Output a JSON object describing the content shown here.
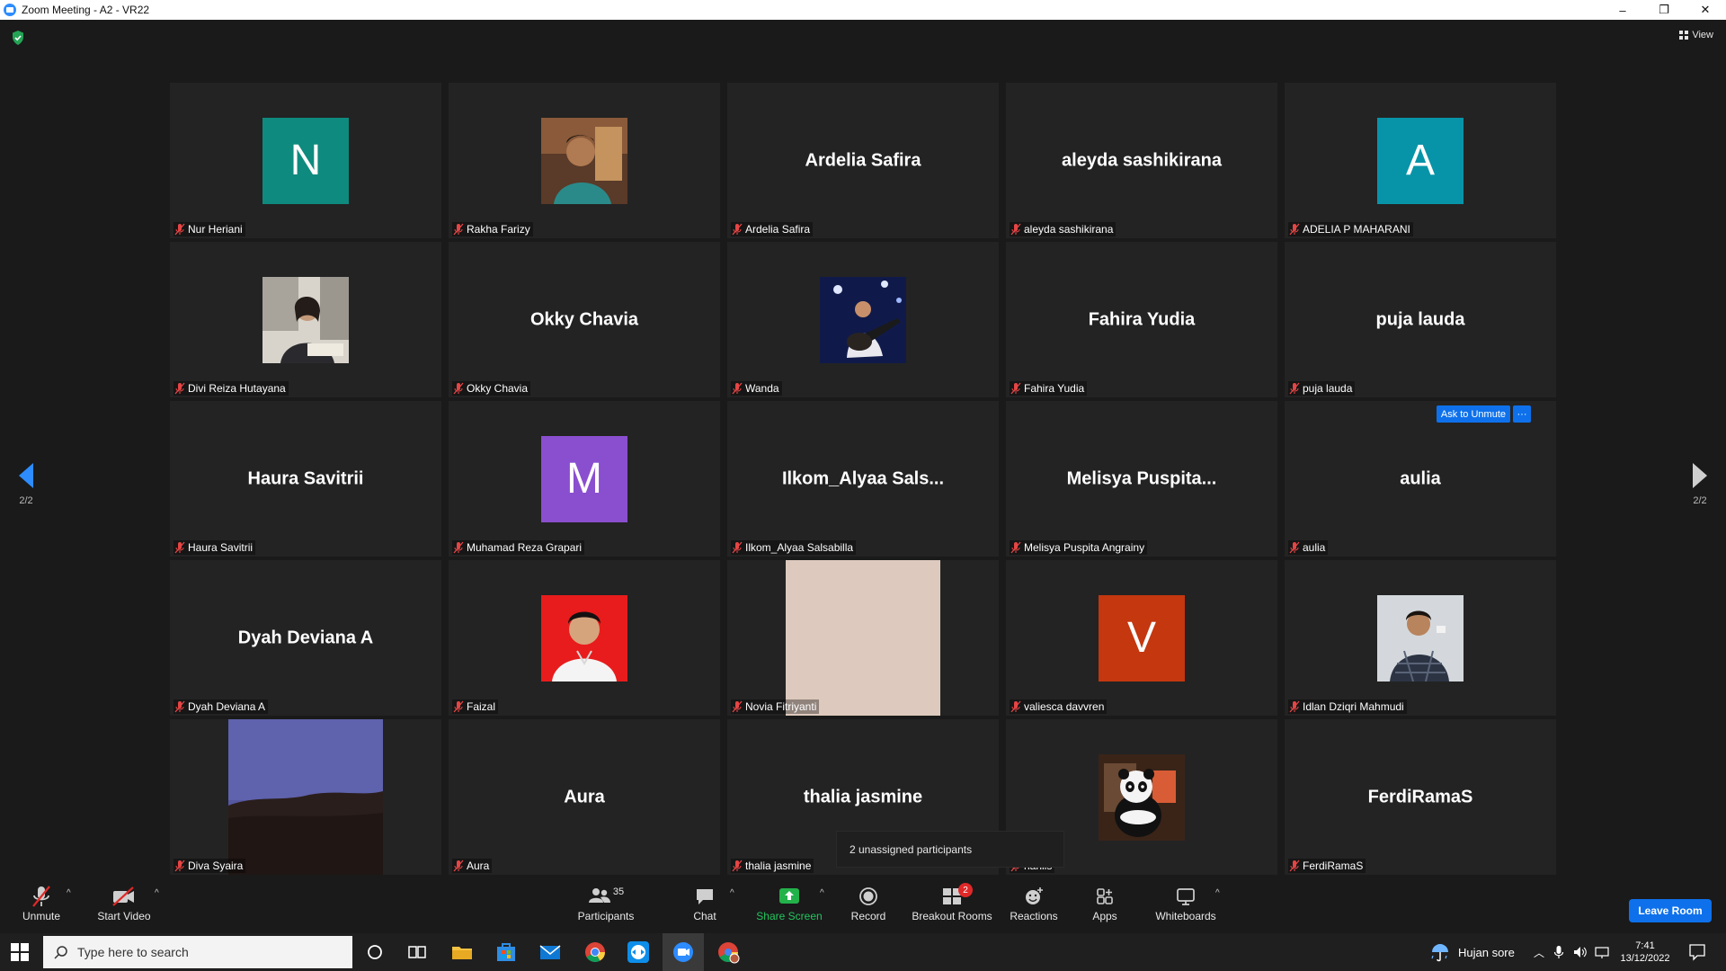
{
  "window": {
    "title": "Zoom Meeting - A2 - VR22",
    "minimize": "–",
    "maximize": "❐",
    "close": "✕"
  },
  "meeting": {
    "view_label": "View",
    "page_indicator": "2/2",
    "ask_to_unmute": "Ask to Unmute",
    "more": "···",
    "breakout_tip": "2 unassigned participants"
  },
  "participants": [
    {
      "name": "Nur Heriani",
      "display": "avatar",
      "initial": "N",
      "color": "#0f8a7e"
    },
    {
      "name": "Rakha Farizy",
      "display": "photo",
      "photo": "rakha"
    },
    {
      "name": "Ardelia Safira",
      "display": "name",
      "center": "Ardelia Safira"
    },
    {
      "name": "aleyda sashikirana",
      "display": "name",
      "center": "aleyda sashikirana"
    },
    {
      "name": "ADELIA P MAHARANI",
      "display": "avatar",
      "initial": "A",
      "color": "#0894a8"
    },
    {
      "name": "Divi Reiza Hutayana",
      "display": "photo",
      "photo": "divi"
    },
    {
      "name": "Okky Chavia",
      "display": "name",
      "center": "Okky Chavia"
    },
    {
      "name": "Wanda",
      "display": "photo",
      "photo": "wanda"
    },
    {
      "name": "Fahira Yudia",
      "display": "name",
      "center": "Fahira Yudia"
    },
    {
      "name": "puja lauda",
      "display": "name",
      "center": "puja lauda"
    },
    {
      "name": "Haura Savitrii",
      "display": "name",
      "center": "Haura Savitrii"
    },
    {
      "name": "Muhamad Reza Grapari",
      "display": "avatar",
      "initial": "M",
      "color": "#8a4fcf"
    },
    {
      "name": "Ilkom_Alyaa Salsabilla",
      "display": "name",
      "center": "Ilkom_Alyaa  Sals..."
    },
    {
      "name": "Melisya Puspita Angrainy",
      "display": "name",
      "center": "Melisya  Puspita..."
    },
    {
      "name": "aulia",
      "display": "name",
      "center": "aulia"
    },
    {
      "name": "Dyah Deviana A",
      "display": "name",
      "center": "Dyah Deviana A"
    },
    {
      "name": "Faizal",
      "display": "photo",
      "photo": "faizal"
    },
    {
      "name": "Novia Fitriyanti",
      "display": "bigphoto",
      "photo": "novia"
    },
    {
      "name": "valiesca davvren",
      "display": "avatar",
      "initial": "V",
      "color": "#c4370f"
    },
    {
      "name": "Idlan Dziqri Mahmudi",
      "display": "photo",
      "photo": "idlan"
    },
    {
      "name": "Diva Syaira",
      "display": "bigphoto",
      "photo": "diva"
    },
    {
      "name": "Aura",
      "display": "name",
      "center": "Aura"
    },
    {
      "name": "thalia jasmine",
      "display": "name",
      "center": "thalia jasmine"
    },
    {
      "name": "harilis",
      "display": "photo",
      "photo": "panda"
    },
    {
      "name": "FerdiRamaS",
      "display": "name",
      "center": "FerdiRamaS"
    }
  ],
  "toolbar": {
    "unmute": "Unmute",
    "start_video": "Start Video",
    "participants": "Participants",
    "participants_count": "35",
    "chat": "Chat",
    "share_screen": "Share Screen",
    "record": "Record",
    "breakout_rooms": "Breakout Rooms",
    "breakout_badge": "2",
    "reactions": "Reactions",
    "apps": "Apps",
    "whiteboards": "Whiteboards",
    "leave_room": "Leave Room",
    "caret": "^"
  },
  "taskbar": {
    "search_placeholder": "Type here to search",
    "weather": "Hujan sore",
    "time": "7:41",
    "date": "13/12/2022"
  }
}
